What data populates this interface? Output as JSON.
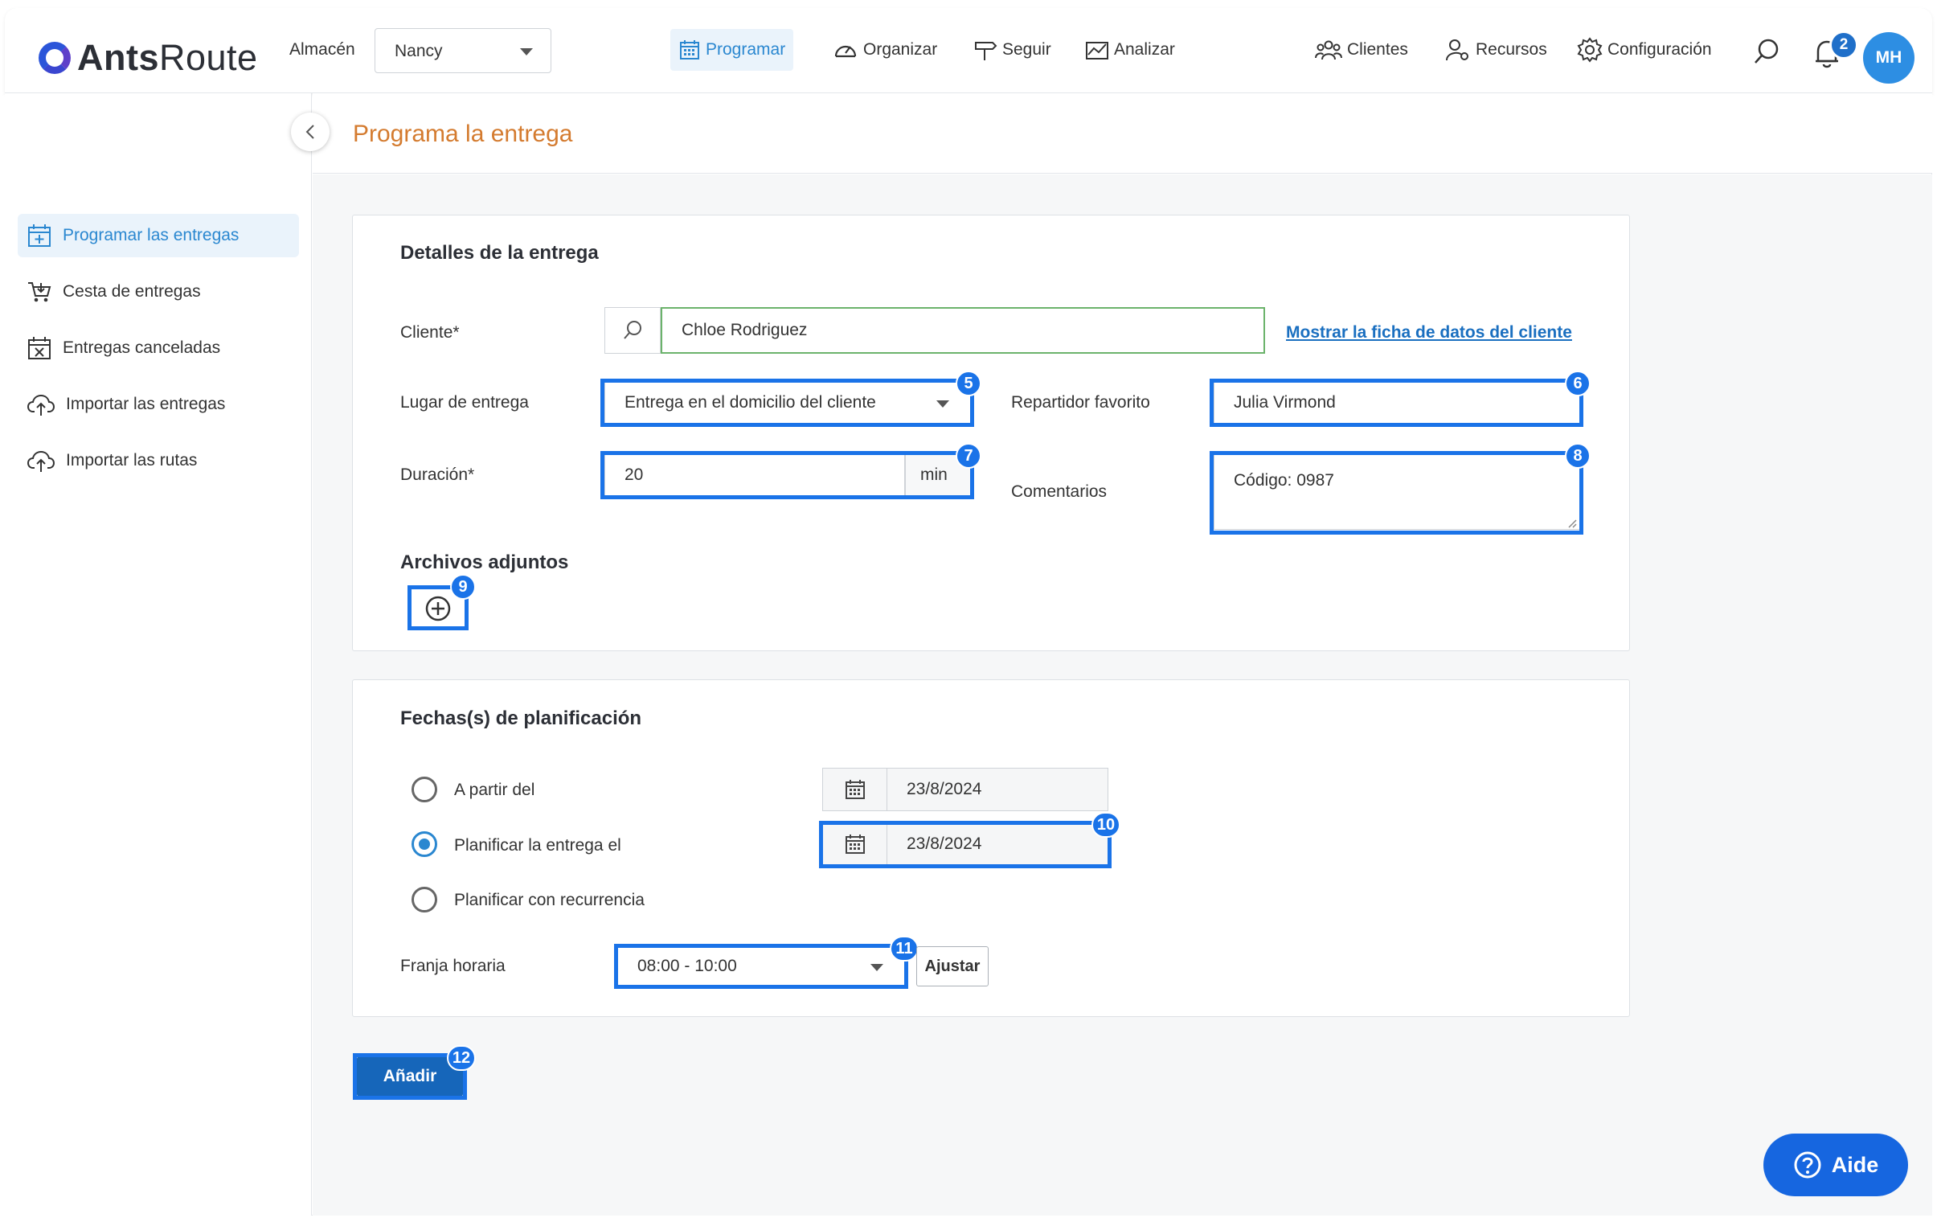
{
  "brand": {
    "name_bold": "Ants",
    "name_rest": "Route"
  },
  "header": {
    "warehouse_label": "Almacén",
    "warehouse_value": "Nancy",
    "nav": [
      {
        "label": "Programar",
        "active": true
      },
      {
        "label": "Organizar"
      },
      {
        "label": "Seguir"
      },
      {
        "label": "Analizar"
      }
    ],
    "right_nav": [
      {
        "label": "Clientes"
      },
      {
        "label": "Recursos"
      },
      {
        "label": "Configuración"
      }
    ],
    "notifications_count": "2",
    "avatar_initials": "MH"
  },
  "sidebar": {
    "items": [
      {
        "label": "Programar las entregas",
        "icon": "calendar-plus-icon",
        "active": true
      },
      {
        "label": "Cesta de entregas",
        "icon": "cart-icon"
      },
      {
        "label": "Entregas canceladas",
        "icon": "calendar-x-icon"
      },
      {
        "label": "Importar las entregas",
        "icon": "cloud-upload-icon"
      },
      {
        "label": "Importar las rutas",
        "icon": "cloud-upload-icon"
      }
    ]
  },
  "page": {
    "title": "Programa la entrega"
  },
  "details": {
    "title": "Detalles de la entrega",
    "client_label": "Cliente*",
    "client_value": "Chloe Rodriguez",
    "client_link": "Mostrar la ficha de datos del cliente",
    "place_label": "Lugar de entrega",
    "place_value": "Entrega en el domicilio del cliente",
    "driver_label": "Repartidor favorito",
    "driver_value": "Julia Virmond",
    "duration_label": "Duración*",
    "duration_value": "20",
    "duration_unit": "min",
    "comments_label": "Comentarios",
    "comments_value": "Código: 0987",
    "attachments_title": "Archivos adjuntos"
  },
  "planning": {
    "title": "Fechas(s) de planificación",
    "options": [
      {
        "label": "A partir del",
        "checked": false,
        "date": "23/8/2024"
      },
      {
        "label": "Planificar la entrega el",
        "checked": true,
        "date": "23/8/2024"
      },
      {
        "label": "Planificar con recurrencia",
        "checked": false
      }
    ],
    "timeslot_label": "Franja horaria",
    "timeslot_value": "08:00 - 10:00",
    "adjust_label": "Ajustar"
  },
  "actions": {
    "add_label": "Añadir"
  },
  "help": {
    "label": "Aide"
  },
  "badges": [
    "5",
    "6",
    "7",
    "8",
    "9",
    "10",
    "11",
    "12"
  ],
  "colors": {
    "highlight": "#1a73e8",
    "primary": "#1666ba",
    "title_orange": "#d47b2f",
    "link": "#1a6fc0",
    "active_bg": "#eaf3fb"
  }
}
